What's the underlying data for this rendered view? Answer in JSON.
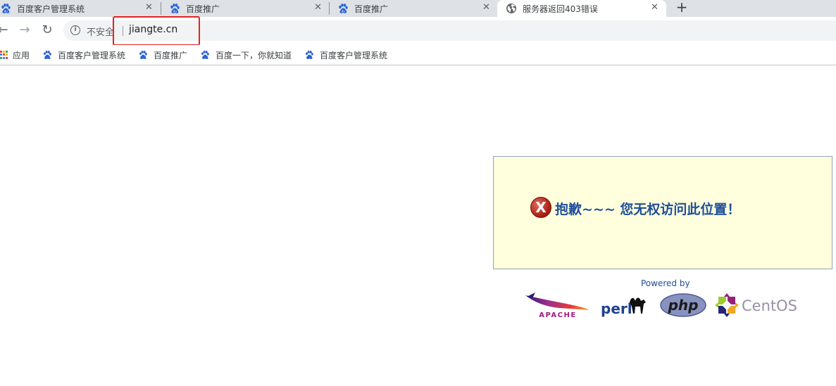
{
  "tabs": [
    {
      "title": "百度客户管理系统",
      "icon": "baidu-paw-icon",
      "close": "✕"
    },
    {
      "title": "百度推广",
      "icon": "baidu-paw-icon",
      "close": "✕"
    },
    {
      "title": "百度推广",
      "icon": "baidu-paw-icon",
      "close": "✕"
    },
    {
      "title": "服务器返回403错误",
      "icon": "globe-icon",
      "close": "✕",
      "active": true
    }
  ],
  "new_tab": "+",
  "toolbar": {
    "back": "←",
    "forward": "→",
    "reload": "↻",
    "security_label": "不安全",
    "info_glyph": "i",
    "url": "jiangte.cn"
  },
  "bookmarks": [
    {
      "label": "应用",
      "icon": "apps-grid-icon"
    },
    {
      "label": "百度客户管理系统",
      "icon": "baidu-paw-icon"
    },
    {
      "label": "百度推广",
      "icon": "baidu-paw-icon"
    },
    {
      "label": "百度一下，你就知道",
      "icon": "baidu-paw-icon"
    },
    {
      "label": "百度客户管理系统",
      "icon": "baidu-paw-icon"
    }
  ],
  "content": {
    "error_icon_glyph": "X",
    "error_message": "抱歉~~~ 您无权访问此位置！",
    "powered_by": "Powered by",
    "logos": {
      "apache": "APACHE",
      "perl": "perl",
      "php": "php",
      "centos": "CentOS"
    }
  },
  "colors": {
    "tabstrip": "#dee1e6",
    "error_bg": "#ffffdd",
    "error_text": "#1f4e9a",
    "highlight": "#e0241f",
    "baidu_blue": "#2b62d6"
  }
}
